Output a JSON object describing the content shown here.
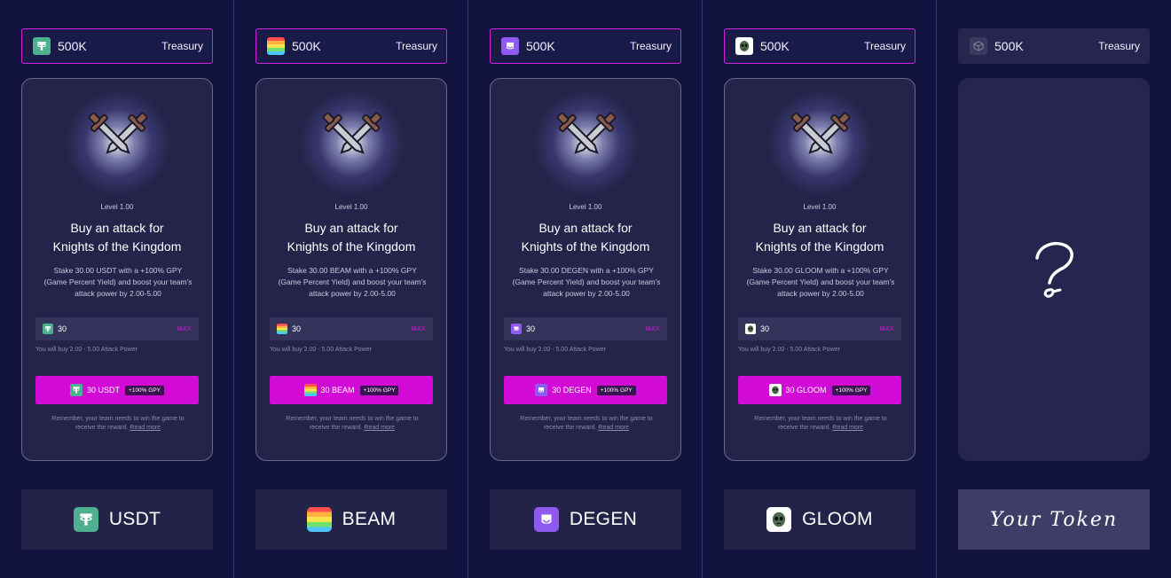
{
  "columns": [
    {
      "token": "USDT",
      "icon": "usdt-icon",
      "treasury_amount": "500K",
      "treasury_label": "Treasury",
      "level": "Level 1.00",
      "headline_1": "Buy an attack for",
      "headline_2": "Knights of the Kingdom",
      "desc_1": "Stake 30.00 USDT with a +100% GPY",
      "desc_2": "(Game Percent Yield) and boost your team's",
      "desc_3": "attack power by 2.00-5.00",
      "input_value": "30",
      "max_label": "MAX",
      "hint": "You will buy 2.00 - 5.00 Attack Power",
      "button_label": "30 USDT",
      "gpy_badge": "+100% GPY",
      "remember_1": "Remember, your team needs to win the game to",
      "remember_2": "receive the reward.",
      "read_more": "Read more",
      "tile_name": "USDT"
    },
    {
      "token": "BEAM",
      "icon": "beam-icon",
      "treasury_amount": "500K",
      "treasury_label": "Treasury",
      "level": "Level 1.00",
      "headline_1": "Buy an attack for",
      "headline_2": "Knights of the Kingdom",
      "desc_1": "Stake 30.00 BEAM with a +100% GPY",
      "desc_2": "(Game Percent Yield) and boost your team's",
      "desc_3": "attack power by 2.00-5.00",
      "input_value": "30",
      "max_label": "MAX",
      "hint": "You will buy 2.00 - 5.00 Attack Power",
      "button_label": "30 BEAM",
      "gpy_badge": "+100% GPY",
      "remember_1": "Remember, your team needs to win the game to",
      "remember_2": "receive the reward.",
      "read_more": "Read more",
      "tile_name": "BEAM"
    },
    {
      "token": "DEGEN",
      "icon": "degen-icon",
      "treasury_amount": "500K",
      "treasury_label": "Treasury",
      "level": "Level 1.00",
      "headline_1": "Buy an attack for",
      "headline_2": "Knights of the Kingdom",
      "desc_1": "Stake 30.00 DEGEN with a +100% GPY",
      "desc_2": "(Game Percent Yield) and boost your team's",
      "desc_3": "attack power by 2.00-5.00",
      "input_value": "30",
      "max_label": "MAX",
      "hint": "You will buy 2.00 - 5.00 Attack Power",
      "button_label": "30 DEGEN",
      "gpy_badge": "+100% GPY",
      "remember_1": "Remember, your team needs to win the game to",
      "remember_2": "receive the reward.",
      "read_more": "Read more",
      "tile_name": "DEGEN"
    },
    {
      "token": "GLOOM",
      "icon": "gloom-icon",
      "treasury_amount": "500K",
      "treasury_label": "Treasury",
      "level": "Level 1.00",
      "headline_1": "Buy an attack for",
      "headline_2": "Knights of the Kingdom",
      "desc_1": "Stake 30.00 GLOOM with a +100% GPY",
      "desc_2": "(Game Percent Yield) and boost your team's",
      "desc_3": "attack power by 2.00-5.00",
      "input_value": "30",
      "max_label": "MAX",
      "hint": "You will buy 2.00 - 5.00 Attack Power",
      "button_label": "30 GLOOM",
      "gpy_badge": "+100% GPY",
      "remember_1": "Remember, your team needs to win the game to",
      "remember_2": "receive the reward.",
      "read_more": "Read more",
      "tile_name": "GLOOM"
    }
  ],
  "placeholder_column": {
    "icon": "cube-icon",
    "treasury_amount": "500K",
    "treasury_label": "Treasury",
    "question_icon": "question-mark-icon",
    "tile_name": "Your Token"
  },
  "colors": {
    "background": "#13133f",
    "accent": "#d10ad6",
    "card": "#24244a",
    "usdt": "#4fb08f",
    "degen": "#8e5af0"
  }
}
